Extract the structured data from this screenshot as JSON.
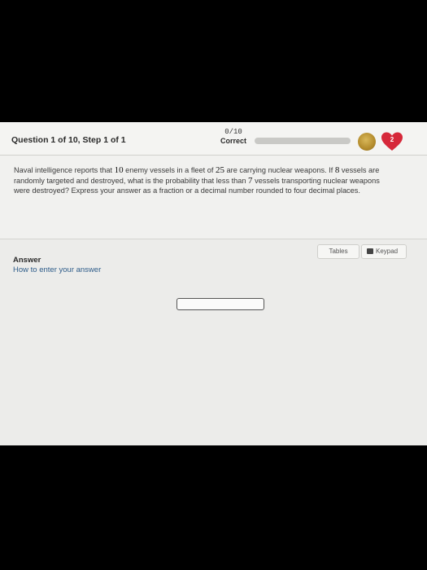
{
  "header": {
    "question_title": "Question 1 of 10, Step 1 of 1",
    "score_fraction": "0/10",
    "score_label": "Correct",
    "progress_fraction": 0.0,
    "hearts_count": "2",
    "accent_heart": "#d6283a",
    "coin_color": "#c09a3a"
  },
  "question": {
    "text_part1": "Naval intelligence reports that ",
    "n_enemy": "10",
    "text_part2": " enemy vessels in a fleet of ",
    "n_fleet": "25",
    "text_part3": " are carrying nuclear weapons. If ",
    "n_targeted": "8",
    "text_part4": " vessels are randomly targeted and destroyed, what is the probability that less than ",
    "n_less": "7",
    "text_part5": " vessels transporting nuclear weapons were destroyed? Express your answer as a fraction or a decimal number rounded to four decimal places."
  },
  "answer": {
    "tables_label": "Tables",
    "keypad_label": "Keypad",
    "answer_label": "Answer",
    "how_to_link": "How to enter your answer",
    "input_value": ""
  }
}
